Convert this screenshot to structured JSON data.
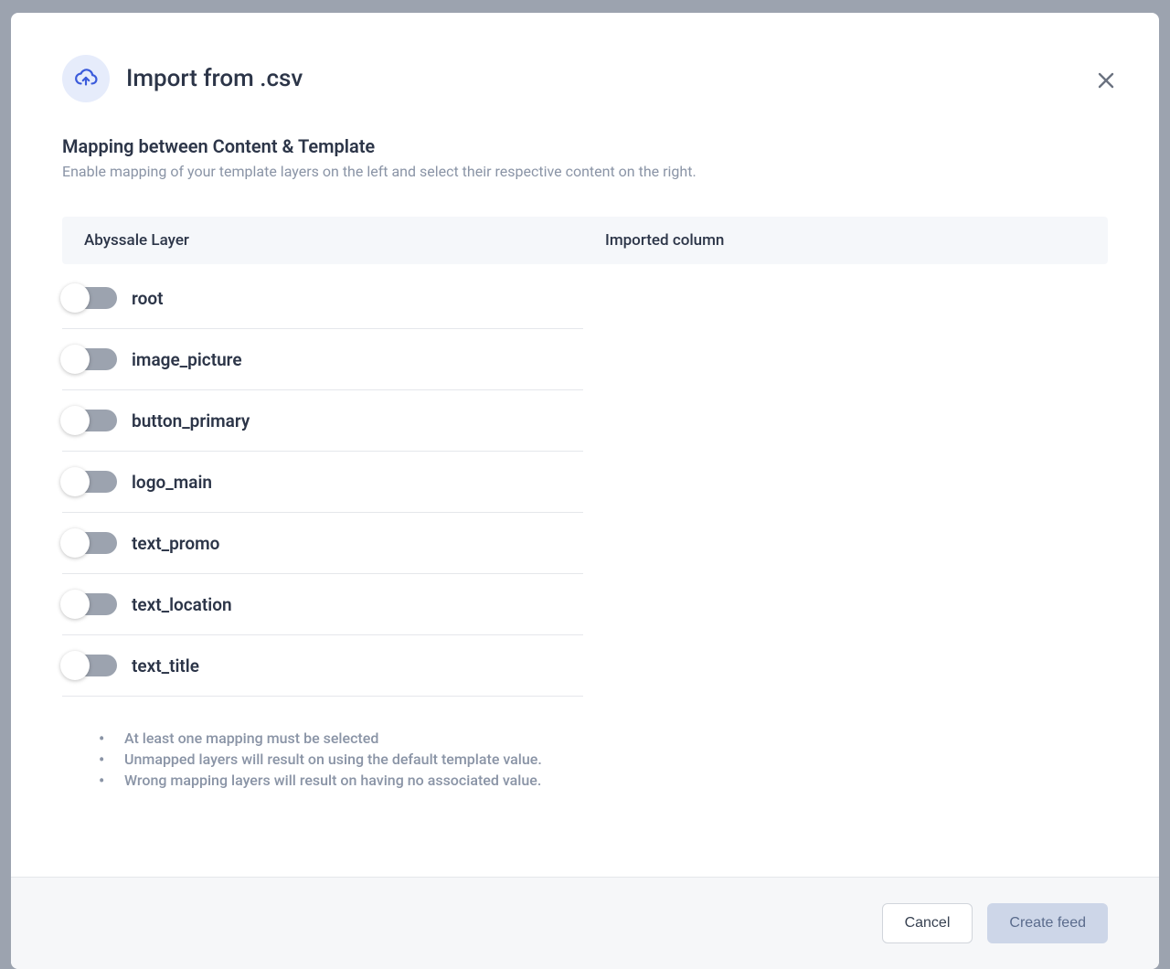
{
  "modal": {
    "title": "Import from .csv",
    "icon": "upload-cloud-icon"
  },
  "mapping": {
    "heading": "Mapping between Content & Template",
    "subheading": "Enable mapping of your template layers on the left and select their respective content on the right.",
    "columns": {
      "left": "Abyssale Layer",
      "right": "Imported column"
    },
    "layers": [
      {
        "name": "root",
        "enabled": false
      },
      {
        "name": "image_picture",
        "enabled": false
      },
      {
        "name": "button_primary",
        "enabled": false
      },
      {
        "name": "logo_main",
        "enabled": false
      },
      {
        "name": "text_promo",
        "enabled": false
      },
      {
        "name": "text_location",
        "enabled": false
      },
      {
        "name": "text_title",
        "enabled": false
      }
    ],
    "hints": [
      "At least one mapping must be selected",
      "Unmapped layers will result on using the default template value.",
      "Wrong mapping layers will result on having no associated value."
    ]
  },
  "footer": {
    "cancel": "Cancel",
    "confirm": "Create feed"
  }
}
